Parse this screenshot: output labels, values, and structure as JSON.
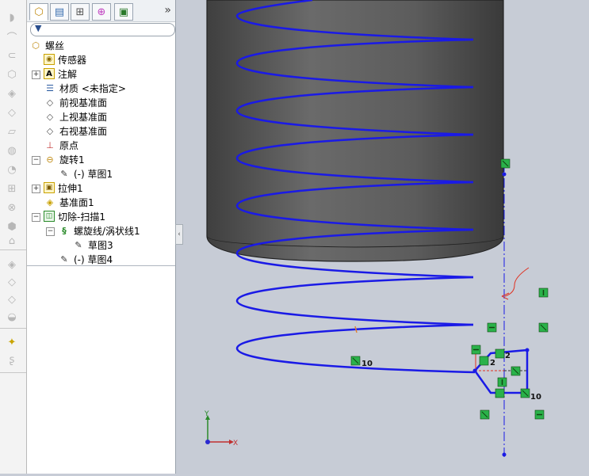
{
  "feature_tree": {
    "part_name": "螺丝",
    "items": [
      {
        "label": "传感器"
      },
      {
        "label": "注解"
      },
      {
        "label": "材质 <未指定>"
      },
      {
        "label": "前视基准面"
      },
      {
        "label": "上视基准面"
      },
      {
        "label": "右视基准面"
      },
      {
        "label": "原点"
      },
      {
        "label": "旋转1"
      },
      {
        "label": "(-) 草图1"
      },
      {
        "label": "拉伸1"
      },
      {
        "label": "基准面1"
      },
      {
        "label": "切除-扫描1"
      },
      {
        "label": "螺旋线/涡状线1"
      },
      {
        "label": "草图3"
      },
      {
        "label": "(-) 草图4"
      }
    ]
  },
  "sketch": {
    "dim_labels": [
      "10",
      "2",
      "2",
      "10"
    ]
  },
  "triad": {
    "x_label": "X",
    "y_label": "Y"
  },
  "colors": {
    "helix": "#1a1ae6",
    "cylinder_body": "#5a5a5a",
    "viewport_bg": "#c7ccd6",
    "relation_marker": "#2ab24a",
    "arrow_annotation": "#e03020"
  }
}
